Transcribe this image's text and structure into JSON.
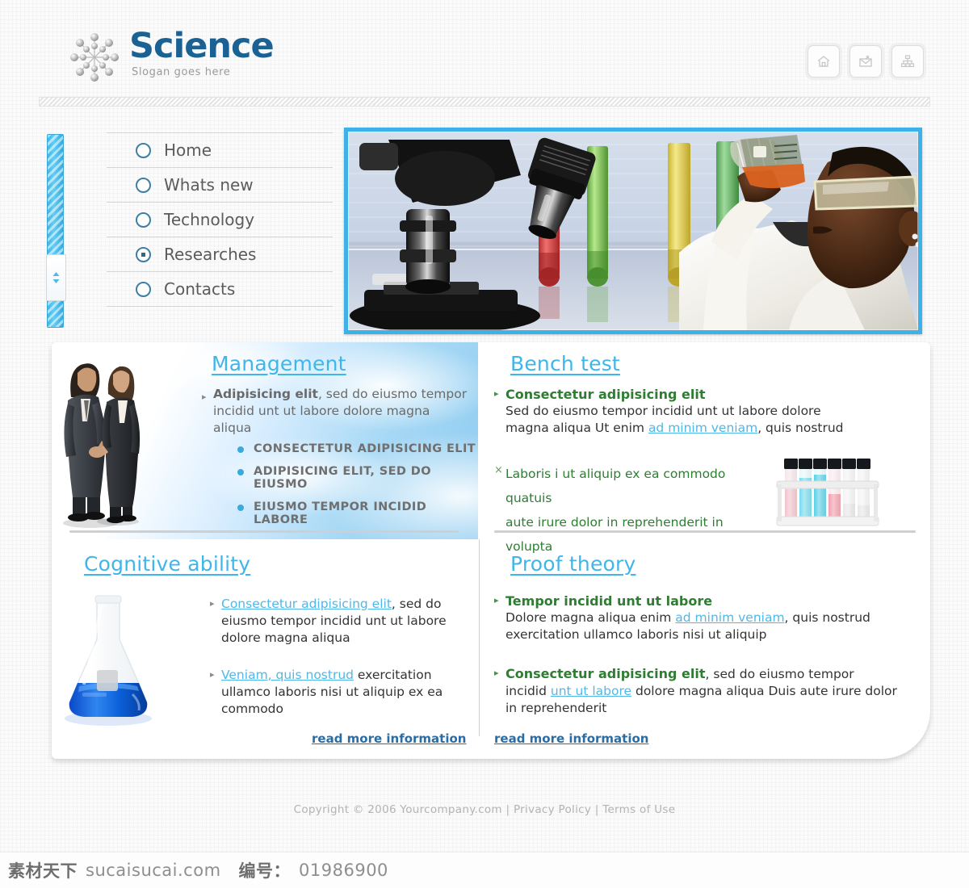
{
  "header": {
    "brand": "Science",
    "slogan": "Slogan goes here",
    "icons": [
      {
        "name": "home-icon",
        "label": "Home"
      },
      {
        "name": "mail-icon",
        "label": "Contact"
      },
      {
        "name": "sitemap-icon",
        "label": "Sitemap"
      }
    ]
  },
  "nav": {
    "items": [
      {
        "label": "Home",
        "selected": false
      },
      {
        "label": "Whats new",
        "selected": false
      },
      {
        "label": "Technology",
        "selected": false
      },
      {
        "label": "Researches",
        "selected": true
      },
      {
        "label": "Contacts",
        "selected": false
      }
    ]
  },
  "hero": {
    "alt": "microscope-and-test-tubes-with-scientist-holding-flask"
  },
  "management": {
    "title": "Management",
    "lead_bold": "Adipisicing elit",
    "lead_rest": ", sed do eiusmo tempor incidid unt ut labore dolore magna aliqua",
    "bullets": [
      "CONSECTETUR ADIPISICING ELIT",
      "ADIPISICING ELIT, SED DO EIUSMO",
      "EIUSMO TEMPOR INCIDID LABORE"
    ],
    "image_alt": "two-business-people-shaking-hands"
  },
  "bench_test": {
    "title": "Bench test",
    "item1_heading": "Consectetur adipisicing elit",
    "item1_text_a": "Sed do eiusmo tempor incidid unt ut labore dolore magna aliqua Ut enim ",
    "item1_link": "ad minim veniam",
    "item1_text_b": ", quis nostrud",
    "item2_line1": "Laboris i ut aliquip ex ea commodo quatuis",
    "item2_line2": "aute irure dolor in reprehenderit in volupta",
    "image_alt": "rack-of-colored-test-tubes"
  },
  "cognitive": {
    "title": "Cognitive ability",
    "item1_link": "Consectetur adipisicing elit",
    "item1_text": ", sed do eiusmo tempor incidid unt ut labore dolore magna aliqua",
    "item2_link": "Veniam, quis nostrud",
    "item2_text": " exercitation ullamco laboris nisi ut aliquip ex ea commodo",
    "read_more": "read more information",
    "image_alt": "erlenmeyer-flask-with-blue-liquid"
  },
  "proof_theory": {
    "title": "Proof theory",
    "item1_heading": "Tempor incidid unt ut labore",
    "item1_text_a": "Dolore magna aliqua enim ",
    "item1_link": "ad minim veniam",
    "item1_text_b": ", quis nostrud exercitation ullamco laboris nisi ut aliquip",
    "item2_heading": "Consectetur adipisicing elit",
    "item2_text_a": ", sed do eiusmo tempor incidid ",
    "item2_link": "unt ut labore",
    "item2_text_b": " dolore magna aliqua Duis aute irure dolor in reprehenderit",
    "read_more": "read more information"
  },
  "footer": {
    "copyright": "Copyright © 2006 Yourcompany.com",
    "sep1": "|",
    "privacy": "Privacy Policy",
    "sep2": "|",
    "terms": "Terms of Use"
  },
  "watermark": {
    "site_cn": "素材天下",
    "site": "sucaisucai.com",
    "id_label": "编号：",
    "id_value": "01986900"
  },
  "colors": {
    "brand_blue": "#1c6193",
    "accent_cyan": "#3fb6ea",
    "heading_green": "#2e7d32",
    "link_blue": "#2b6ca3"
  }
}
